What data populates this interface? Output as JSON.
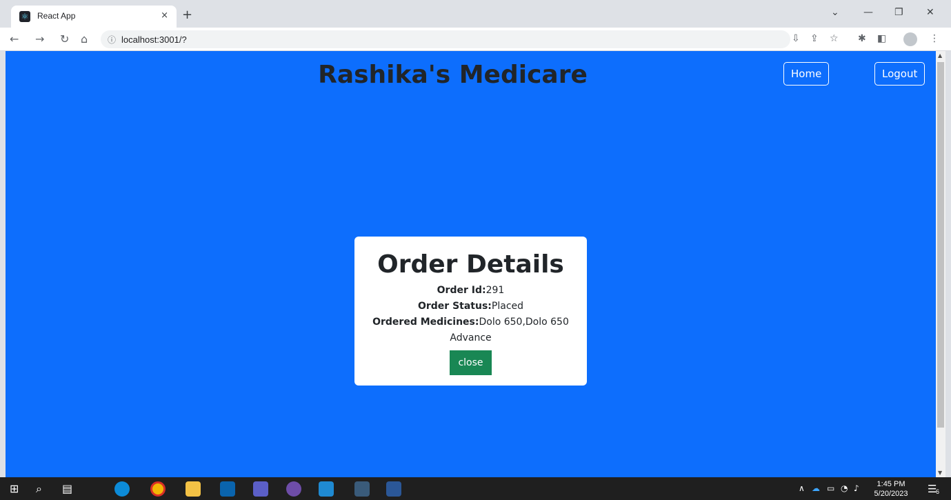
{
  "browser": {
    "tab_title": "React App",
    "tab_close": "×",
    "new_tab": "+",
    "url": "localhost:3001/?",
    "window_controls": [
      "⌄",
      "—",
      "❐",
      "✕"
    ]
  },
  "header": {
    "site_title": "Rashika's Medicare",
    "home_label": "Home",
    "logout_label": "Logout"
  },
  "modal": {
    "title": "Order Details",
    "order_id_label": "Order Id:",
    "order_id_value": "291",
    "status_label": "Order Status:",
    "status_value": "Placed",
    "medicines_label": "Ordered Medicines:",
    "medicines_value": "Dolo 650,Dolo 650 Advance",
    "close_label": "close"
  },
  "taskbar": {
    "time": "1:45 PM",
    "date": "5/20/2023",
    "notification_count": "6"
  },
  "colors": {
    "page_bg": "#0d6efd",
    "close_button": "#198754"
  }
}
